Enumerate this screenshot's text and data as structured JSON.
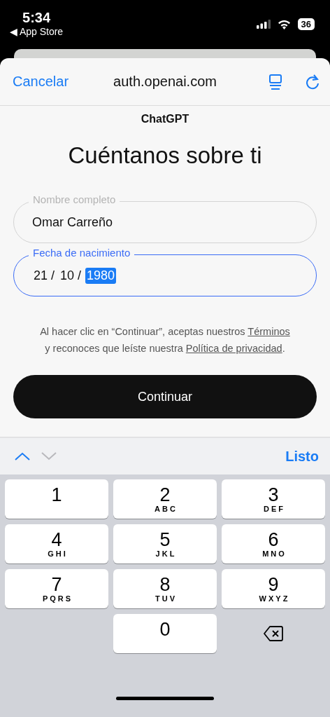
{
  "status_bar": {
    "time": "5:34",
    "back_label": "◀ App Store",
    "battery": "36"
  },
  "nav": {
    "cancel": "Cancelar",
    "title": "auth.openai.com"
  },
  "brand": "ChatGPT",
  "heading": "Cuéntanos sobre ti",
  "fields": [
    {
      "kind": "text",
      "label": "Nombre completo",
      "value": "Omar Carreño",
      "focused": false
    },
    {
      "kind": "date",
      "label": "Fecha de nacimiento",
      "focused": true,
      "segments": [
        {
          "text": "21 /",
          "selected": false
        },
        {
          "text": "10 /",
          "selected": false
        },
        {
          "text": "1980",
          "selected": true
        }
      ]
    }
  ],
  "terms": [
    [
      {
        "kind": "text",
        "text": "Al hacer clic en “Continuar”, aceptas nuestros "
      },
      {
        "kind": "link",
        "text": "Términos"
      }
    ],
    [
      {
        "kind": "text",
        "text": "y reconoces que leíste nuestra "
      },
      {
        "kind": "link",
        "text": "Política de privacidad"
      },
      {
        "kind": "text",
        "text": "."
      }
    ]
  ],
  "continue_button": "Continuar",
  "accessory": {
    "up_disabled": false,
    "down_disabled": true,
    "done": "Listo"
  },
  "keys": [
    {
      "kind": "digit",
      "digit": "1"
    },
    {
      "kind": "digit",
      "digit": "2",
      "letters": "ABC"
    },
    {
      "kind": "digit",
      "digit": "3",
      "letters": "DEF"
    },
    {
      "kind": "digit",
      "digit": "4",
      "letters": "GHI"
    },
    {
      "kind": "digit",
      "digit": "5",
      "letters": "JKL"
    },
    {
      "kind": "digit",
      "digit": "6",
      "letters": "MNO"
    },
    {
      "kind": "digit",
      "digit": "7",
      "letters": "PQRS"
    },
    {
      "kind": "digit",
      "digit": "8",
      "letters": "TUV"
    },
    {
      "kind": "digit",
      "digit": "9",
      "letters": "WXYZ"
    },
    {
      "kind": "blank"
    },
    {
      "kind": "digit",
      "digit": "0"
    },
    {
      "kind": "delete"
    }
  ]
}
